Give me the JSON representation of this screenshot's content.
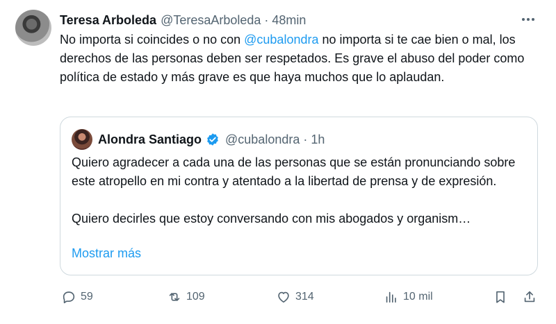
{
  "tweet": {
    "author_name": "Teresa Arboleda",
    "handle_time": "@TeresaArboleda · 48min",
    "text_before": "No importa si coincides o no con ",
    "mention": "@cubalondra",
    "text_after": " no importa si te cae bien o mal, los derechos de las personas deben ser respetados. Es grave el abuso del poder como política de estado y más grave es que haya muchos que lo aplaudan."
  },
  "quote": {
    "author_name": "Alondra Santiago",
    "handle_time": "@cubalondra · 1h",
    "paragraph1": "Quiero agradecer a cada una de las personas que se están pronunciando sobre este atropello en mi contra y atentado a la libertad de prensa y de expresión.",
    "paragraph2": "Quiero decirles que estoy conversando con mis abogados y organism…",
    "show_more": "Mostrar más"
  },
  "actions": {
    "replies": "59",
    "reposts": "109",
    "likes": "314",
    "views": "10 mil"
  },
  "colors": {
    "accent": "#1d9bf0",
    "muted": "#536471",
    "text": "#0f1419",
    "border": "#cfd9de"
  },
  "icons": [
    "more-icon",
    "verified-icon",
    "reply-icon",
    "repost-icon",
    "like-icon",
    "views-icon",
    "bookmark-icon",
    "share-icon"
  ]
}
